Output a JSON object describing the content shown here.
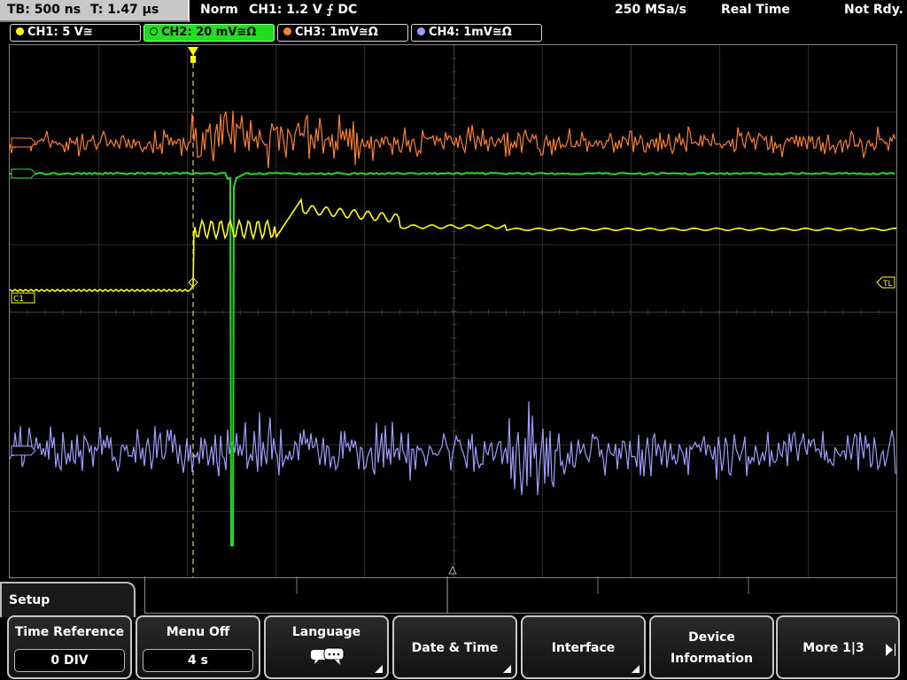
{
  "status_bar": {
    "timebase": "TB: 500 ns",
    "trigger_time": "T: 1.47 µs",
    "trigger_mode": "Norm",
    "trigger_info": "CH1: 1.2 V ⨍ DC",
    "sample_rate": "250 MSa/s",
    "acq_mode": "Real Time",
    "state": "Not Rdy."
  },
  "channels": [
    {
      "label": "CH1: 5 V≅",
      "color": "#ffff00"
    },
    {
      "label": "CH2: 20 mV≅Ω",
      "color": "#22dd22",
      "active": true
    },
    {
      "label": "CH3: 1mV≅Ω",
      "color": "#ff7f2a"
    },
    {
      "label": "CH4: 1mV≅Ω",
      "color": "#9d9dff"
    }
  ],
  "screen": {
    "tl_marker": "TL",
    "c1_marker": "C1",
    "trace_colors": {
      "ch1": "#ffff00",
      "ch2": "#22dd22",
      "ch3": "#ff7f2a",
      "ch4": "#9d9dff"
    }
  },
  "menu": {
    "title": "Setup",
    "softkeys": [
      {
        "label": "Time Reference",
        "value": "0 DIV"
      },
      {
        "label": "Menu Off",
        "value": "4 s"
      },
      {
        "label": "Language",
        "icon": "speech-bubble-icon"
      },
      {
        "label": "Date & Time"
      },
      {
        "label": "Interface"
      },
      {
        "label_line1": "Device",
        "label_line2": "Information"
      },
      {
        "label": "More 1|3"
      }
    ]
  }
}
